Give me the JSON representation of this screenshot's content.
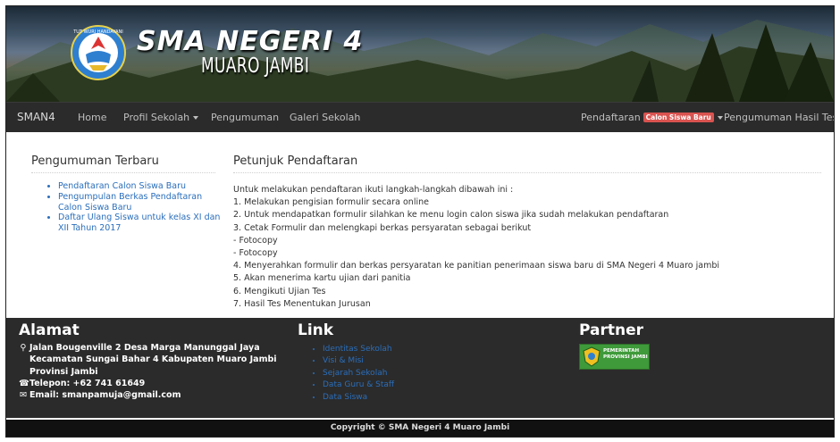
{
  "banner": {
    "school_name": "SMA NEGERI 4",
    "city": "MUARO JAMBI",
    "logo_text": "TUT WURI HANDAYANI"
  },
  "navbar": {
    "brand": "SMAN4",
    "home": "Home",
    "profil": "Profil Sekolah",
    "pengumuman": "Pengumuman",
    "galeri": "Galeri Sekolah",
    "pendaftaran": "Pendaftaran",
    "badge": "Calon Siswa Baru",
    "hasil_tes": "Pengumuman Hasil Tes"
  },
  "sidebar": {
    "title": "Pengumuman Terbaru",
    "items": [
      "Pendaftaran Calon Siswa Baru",
      "Pengumpulan Berkas Pendaftaran Calon Siswa Baru",
      "Daftar Ulang Siswa untuk kelas XI dan XII Tahun 2017"
    ]
  },
  "petunjuk": {
    "title": "Petunjuk Pendaftaran",
    "lines": [
      "Untuk melakukan pendaftaran ikuti langkah-langkah dibawah ini :",
      "1. Melakukan pengisian formulir secara online",
      "2. Untuk mendapatkan formulir silahkan ke menu login calon siswa jika sudah melakukan pendaftaran",
      "3. Cetak Formulir dan melengkapi berkas persyaratan sebagai berikut",
      "- Fotocopy",
      "- Fotocopy",
      "4. Menyerahkan formulir dan berkas persyaratan ke panitian penerimaan siswa baru di SMA Negeri 4 Muaro jambi",
      "5. Akan menerima kartu ujian dari panitia",
      "6. Mengikuti Ujian Tes",
      "7. Hasil Tes Menentukan Jurusan"
    ]
  },
  "footer": {
    "alamat_title": "Alamat",
    "address1": "Jalan Bougenville 2 Desa Marga Manunggal Jaya",
    "address2": "Kecamatan Sungai Bahar 4 Kabupaten Muaro Jambi",
    "address3": "Provinsi Jambi",
    "telepon": "Telepon: +62 741 61649",
    "email": "Email: smanpamuja@gmail.com",
    "link_title": "Link",
    "links": [
      "Identitas Sekolah",
      "Visi & Misi",
      "Sejarah Sekolah",
      "Data Guru & Staff",
      "Data Siswa"
    ],
    "partner_title": "Partner",
    "partner_line1": "PEMERINTAH",
    "partner_line2": "PROVINSI JAMBI",
    "copyright": "Copyright © SMA Negeri 4 Muaro Jambi"
  },
  "colors": {
    "navbar_bg": "#2b2b2b",
    "badge": "#d9534f",
    "link": "#2a6ebb",
    "footer_bg": "#2b2b2b"
  }
}
